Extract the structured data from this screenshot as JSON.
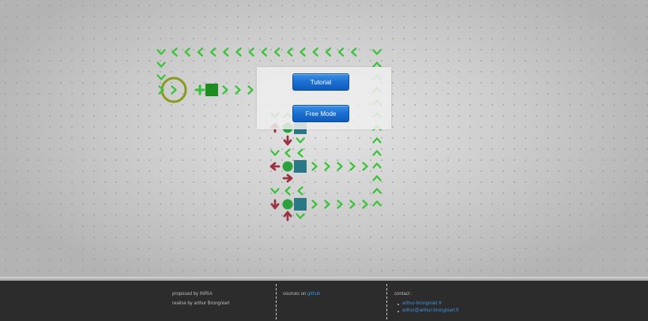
{
  "menu": {
    "tutorial_label": "Tutorial",
    "free_mode_label": "Free Mode"
  },
  "footer": {
    "proposed_by": "proposed by INRIA",
    "realised_by": "realise by arthur Brongniart",
    "sources_prefix": "sources on",
    "sources_link": "github",
    "contact_label": "contact :",
    "contacts": [
      "arthur-brongniart.fr",
      "arthur@arthur-brongniart.fr"
    ]
  },
  "colors": {
    "arrow_green": "#3cc23c",
    "arrow_red": "#9a3344",
    "node_green": "#2aa13c",
    "square_green": "#1e8c1e",
    "square_teal": "#2a7785",
    "selector_ring": "#8a9a1e",
    "button_blue": "#1b6fd1",
    "footer_bg": "#2c2c2c",
    "link_blue": "#3b8fe0"
  }
}
